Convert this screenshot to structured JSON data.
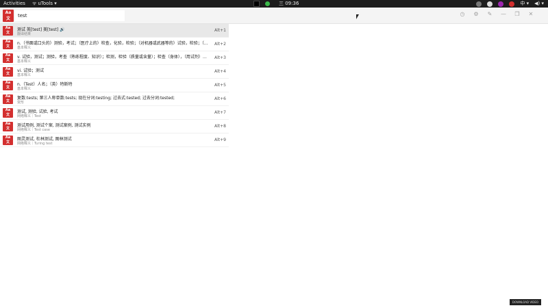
{
  "topbar": {
    "activities": "Activities",
    "app_menu": "uTools ▾",
    "clock": "三 09:36",
    "volume": "◀) ▾"
  },
  "search": {
    "value": "test",
    "app_logo": "Aa"
  },
  "results": [
    {
      "main": "测试 英[test] 美[test]",
      "sub": "翻译结果",
      "hotkey": "Alt+1",
      "speaker": true
    },
    {
      "main": "n.（书面或口头的）测验，考试；（医疗上的）检查，化验，检验；（对机器或武器等的）试验，检验；（…",
      "sub": "基本释义",
      "hotkey": "Alt+2"
    },
    {
      "main": "v. 试验，测试；测验，考查（熟练程度、知识）；检测，检验（质量或含量）；检查（身体），（用试剂）…",
      "sub": "基本释义",
      "hotkey": "Alt+3"
    },
    {
      "main": "vi. 试验；测试",
      "sub": "基本释义",
      "hotkey": "Alt+4"
    },
    {
      "main": "n.（Test）人名；（英）特斯特",
      "sub": "基本释义",
      "hotkey": "Alt+5"
    },
    {
      "main": "复数:tests; 第三人称单数:tests; 现在分词:testing; 过去式:tested; 过去分词:tested;",
      "sub": "变形",
      "hotkey": "Alt+6"
    },
    {
      "main": "测试, 测验, 试验, 考试",
      "sub": "网络释义｜Test",
      "hotkey": "Alt+7"
    },
    {
      "main": "测试用例, 测试个案, 测试案例, 测试实例",
      "sub": "网络释义｜Test case",
      "hotkey": "Alt+8"
    },
    {
      "main": "图灵测试, 杜林测试, 图林测试",
      "sub": "网络释义｜Turing test",
      "hotkey": "Alt+9"
    }
  ],
  "badge": "DOWNLOAD VIDEO"
}
